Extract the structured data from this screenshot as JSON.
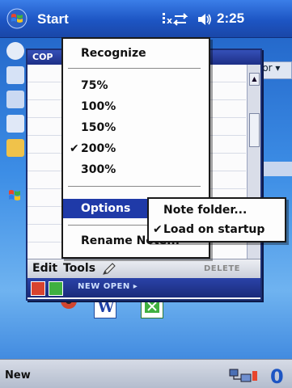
{
  "titlebar": {
    "start_label": "Start",
    "clock": "2:25",
    "icons": [
      "windows-logo-icon",
      "connectivity-icon",
      "speaker-icon"
    ]
  },
  "note_window": {
    "caption": "COP",
    "menubar": {
      "edit": "Edit",
      "tools": "Tools",
      "delete": "DELETE"
    },
    "bottom_toolbar": {
      "label": "NEW OPEN ▸"
    }
  },
  "tools_menu": {
    "items": [
      {
        "label": "Recognize",
        "checked": false
      },
      {
        "label": "75%",
        "checked": false
      },
      {
        "label": "100%",
        "checked": false
      },
      {
        "label": "150%",
        "checked": false
      },
      {
        "label": "200%",
        "checked": true
      },
      {
        "label": "300%",
        "checked": false
      },
      {
        "label": "Options",
        "highlighted": true
      },
      {
        "label": "Rename Note..."
      }
    ]
  },
  "options_submenu": {
    "items": [
      {
        "label": "Note folder...",
        "checked": false
      },
      {
        "label": "Load on startup",
        "checked": true
      }
    ]
  },
  "today_partial_label": "ior ▾",
  "commandbar": {
    "new_label": "New",
    "sip_label": "0"
  },
  "colors": {
    "menu_highlight": "#1f3aa8",
    "titlebar": "#1d55c3"
  }
}
